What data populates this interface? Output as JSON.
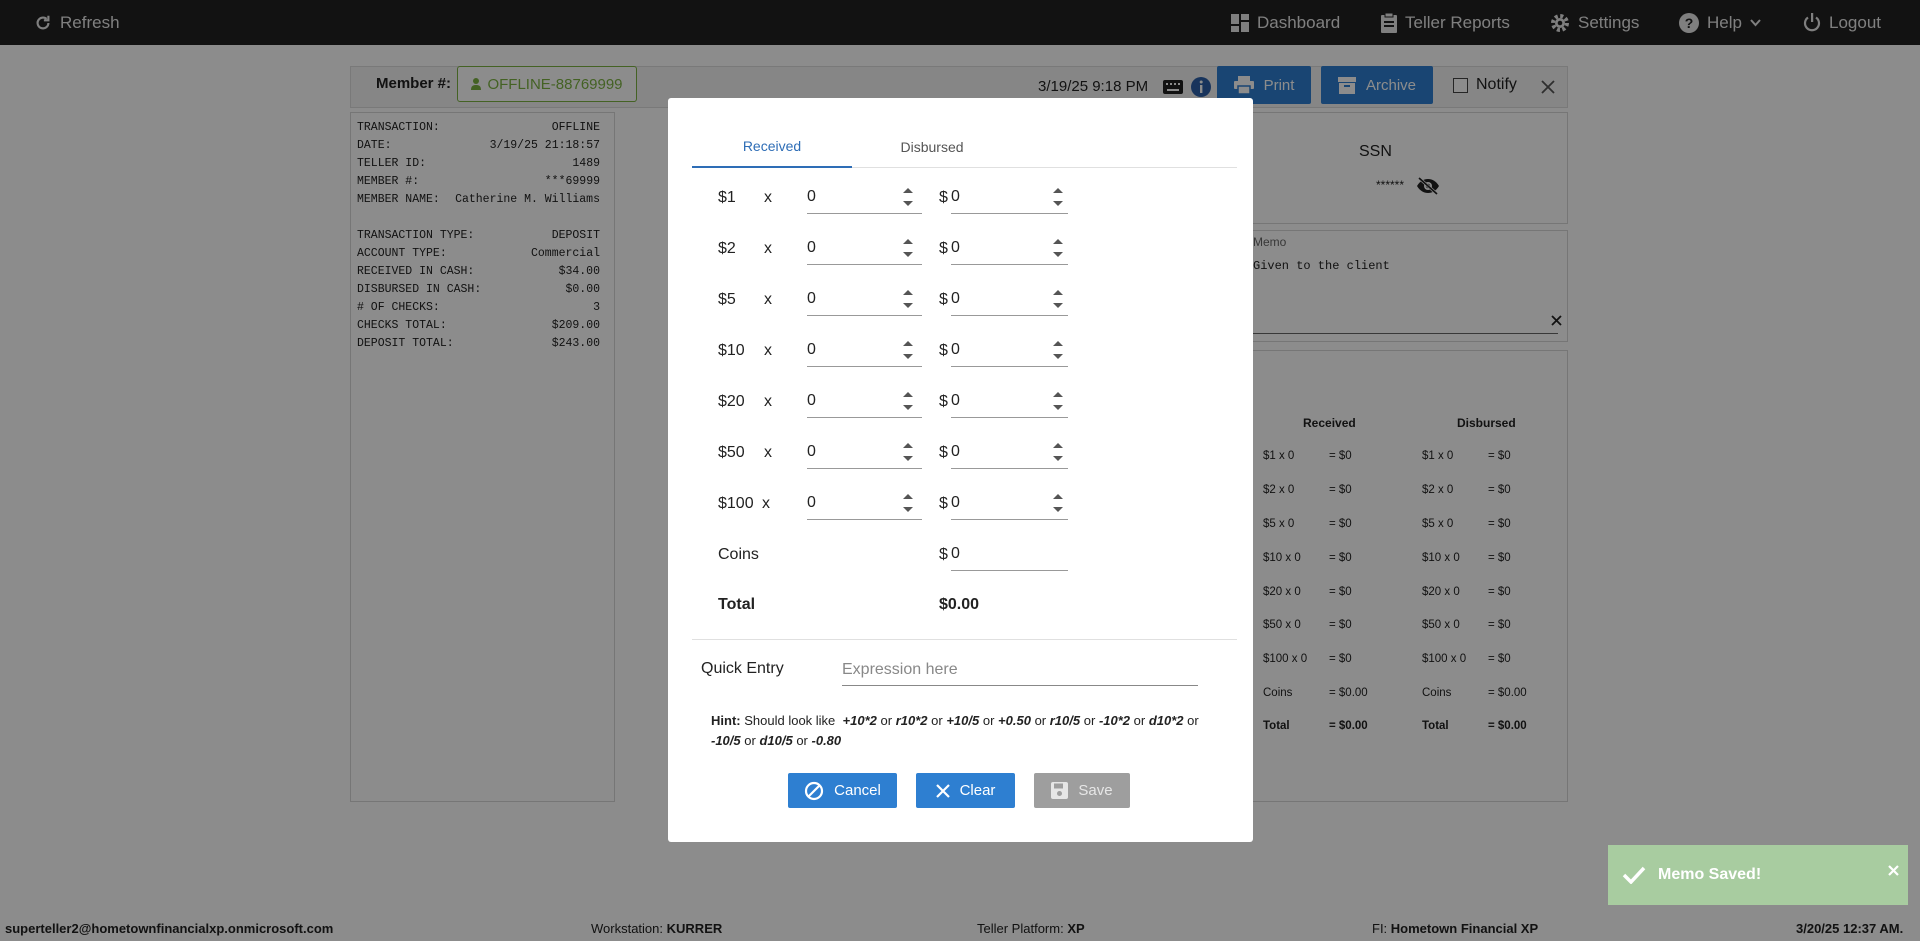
{
  "topbar": {
    "refresh": "Refresh",
    "dashboard": "Dashboard",
    "teller_reports": "Teller Reports",
    "settings": "Settings",
    "help": "Help",
    "logout": "Logout"
  },
  "member": {
    "label": "Member #:",
    "value": "OFFLINE-88769999",
    "datetime": "3/19/25 9:18 PM",
    "print": "Print",
    "archive": "Archive",
    "notify": "Notify"
  },
  "receipt": [
    {
      "k": "TRANSACTION:",
      "v": "OFFLINE"
    },
    {
      "k": "DATE:",
      "v": "3/19/25 21:18:57"
    },
    {
      "k": "TELLER ID:",
      "v": "1489"
    },
    {
      "k": "MEMBER #:",
      "v": "***69999"
    },
    {
      "k": "MEMBER NAME:",
      "v": "Catherine M. Williams"
    },
    {
      "k": "",
      "v": ""
    },
    {
      "k": "TRANSACTION TYPE:",
      "v": "DEPOSIT"
    },
    {
      "k": "ACCOUNT TYPE:",
      "v": "Commercial"
    },
    {
      "k": "RECEIVED IN CASH:",
      "v": "$34.00"
    },
    {
      "k": "DISBURSED IN CASH:",
      "v": "$0.00"
    },
    {
      "k": "# OF CHECKS:",
      "v": "3"
    },
    {
      "k": "CHECKS TOTAL:",
      "v": "$209.00"
    },
    {
      "k": "DEPOSIT TOTAL:",
      "v": "$243.00"
    }
  ],
  "ssn": {
    "label": "SSN",
    "masked": "******"
  },
  "memo": {
    "label": "Memo",
    "text": "Given to the client"
  },
  "summary": {
    "received_header": "Received",
    "disbursed_header": "Disbursed",
    "rows": [
      {
        "label": "$1 x 0",
        "eq": "= $0"
      },
      {
        "label": "$2 x 0",
        "eq": "= $0"
      },
      {
        "label": "$5 x 0",
        "eq": "= $0"
      },
      {
        "label": "$10 x 0",
        "eq": "= $0"
      },
      {
        "label": "$20 x 0",
        "eq": "= $0"
      },
      {
        "label": "$50 x 0",
        "eq": "= $0"
      },
      {
        "label": "$100 x 0",
        "eq": "= $0"
      },
      {
        "label": "Coins",
        "eq": "= $0.00"
      },
      {
        "label": "Total",
        "eq": "= $0.00"
      }
    ]
  },
  "modal": {
    "tab_received": "Received",
    "tab_disbursed": "Disbursed",
    "rows": [
      {
        "den": "$1",
        "count": "0",
        "amount": "0"
      },
      {
        "den": "$2",
        "count": "0",
        "amount": "0"
      },
      {
        "den": "$5",
        "count": "0",
        "amount": "0"
      },
      {
        "den": "$10",
        "count": "0",
        "amount": "0"
      },
      {
        "den": "$20",
        "count": "0",
        "amount": "0"
      },
      {
        "den": "$50",
        "count": "0",
        "amount": "0"
      },
      {
        "den": "$100",
        "count": "0",
        "amount": "0"
      }
    ],
    "x": "x",
    "dollar": "$",
    "coins_label": "Coins",
    "coins_value": "0",
    "total_label": "Total",
    "total_value": "$0.00",
    "quick_entry_label": "Quick Entry",
    "quick_entry_placeholder": "Expression here",
    "hint_label": "Hint:",
    "hint_text": "Should look like",
    "hint_examples": [
      "+10*2",
      "r10*2",
      "+10/5",
      "+0.50",
      "r10/5",
      "-10*2",
      "d10*2",
      "-10/5",
      "d10/5",
      "-0.80"
    ],
    "hint_sep": "or",
    "cancel": "Cancel",
    "clear": "Clear",
    "save": "Save"
  },
  "toast": {
    "text": "Memo Saved!"
  },
  "footer": {
    "user": "superteller2@hometownfinancialxp.onmicrosoft.com",
    "workstation_label": "Workstation:",
    "workstation": "KURRER",
    "platform_label": "Teller Platform:",
    "platform": "XP",
    "fi_label": "FI:",
    "fi": "Hometown Financial XP",
    "datetime": "3/20/25 12:37 AM."
  }
}
